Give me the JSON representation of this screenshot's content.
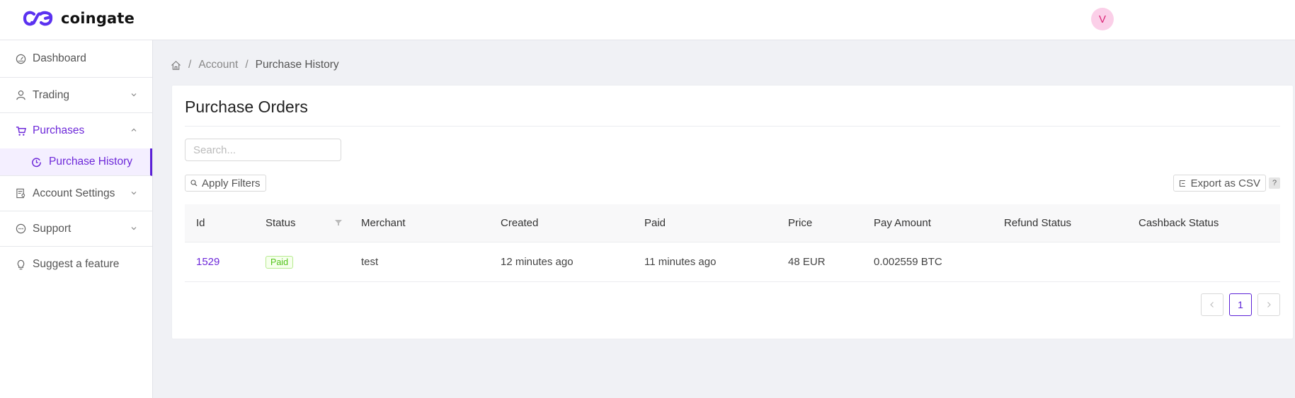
{
  "header": {
    "brand": "coingate",
    "brand_color": "#5b32f0",
    "avatar_initial": "V",
    "avatar_bg": "#fbcfe8",
    "avatar_fg": "#db2777"
  },
  "sidebar": {
    "items": [
      {
        "label": "Dashboard",
        "icon": "dashboard-gauge-icon"
      },
      {
        "label": "Trading",
        "icon": "user-icon",
        "expandable": true
      },
      {
        "label": "Purchases",
        "icon": "cart-icon",
        "expandable": true,
        "expanded": true,
        "active": true
      },
      {
        "label": "Purchase History",
        "icon": "history-icon",
        "sub": true,
        "selected": true
      },
      {
        "label": "Account Settings",
        "icon": "account-settings-icon",
        "expandable": true
      },
      {
        "label": "Support",
        "icon": "chat-icon",
        "expandable": true
      },
      {
        "label": "Suggest a feature",
        "icon": "bulb-icon"
      }
    ]
  },
  "breadcrumb": {
    "items": [
      "Account",
      "Purchase History"
    ]
  },
  "main": {
    "title": "Purchase Orders",
    "search": {
      "value": "",
      "placeholder": "Search..."
    },
    "apply_filters_label": "Apply Filters",
    "export_label": "Export as CSV",
    "help_label": "?",
    "table": {
      "columns": [
        "Id",
        "Status",
        "Merchant",
        "Created",
        "Paid",
        "Price",
        "Pay Amount",
        "Refund Status",
        "Cashback Status"
      ],
      "rows": [
        {
          "id": "1529",
          "status": "Paid",
          "merchant": "test",
          "created": "12 minutes ago",
          "paid": "11 minutes ago",
          "price": "48 EUR",
          "pay_amount": "0.002559 BTC",
          "refund_status": "",
          "cashback_status": ""
        }
      ]
    },
    "pagination": {
      "current": "1",
      "prev": "‹",
      "next": "›"
    }
  },
  "colors": {
    "accent": "#6d28d9",
    "status_paid": "#52c41a"
  }
}
